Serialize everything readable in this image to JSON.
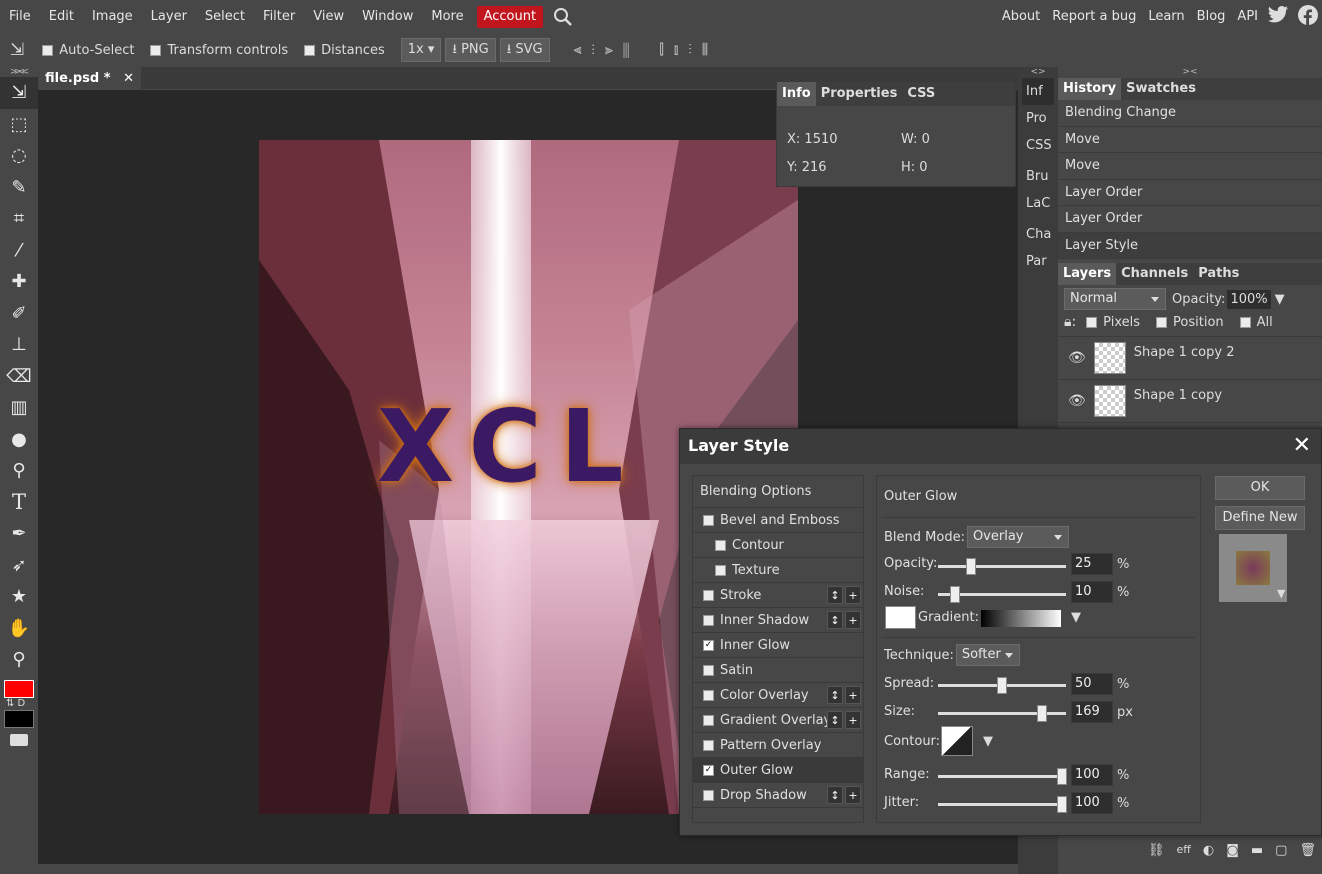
{
  "menu": {
    "items": [
      "File",
      "Edit",
      "Image",
      "Layer",
      "Select",
      "Filter",
      "View",
      "Window",
      "More"
    ],
    "account": "Account",
    "right": [
      "About",
      "Report a bug",
      "Learn",
      "Blog",
      "API"
    ]
  },
  "options": {
    "auto_select": "Auto-Select",
    "transform": "Transform controls",
    "distances": "Distances",
    "zoom": "1x",
    "png": "PNG",
    "svg": "SVG"
  },
  "document": {
    "tab": "file.psd *",
    "art_text": "XCL"
  },
  "info": {
    "tabs": [
      "Info",
      "Properties",
      "CSS"
    ],
    "x": "X: 1510",
    "y": "Y: 216",
    "w": "W: 0",
    "h": "H: 0"
  },
  "strip": [
    "Inf",
    "Pro",
    "CSS",
    "Bru",
    "LaC",
    "Cha",
    "Par"
  ],
  "history": {
    "tabs": [
      "History",
      "Swatches"
    ],
    "items": [
      "Blending Change",
      "Move",
      "Move",
      "Layer Order",
      "Layer Order",
      "Layer Style"
    ]
  },
  "layers": {
    "tabs": [
      "Layers",
      "Channels",
      "Paths"
    ],
    "blend": "Normal",
    "opacity_label": "Opacity:",
    "opacity": "100%",
    "lock_pixels": "Pixels",
    "lock_position": "Position",
    "lock_all": "All",
    "items": [
      "Shape 1 copy 2",
      "Shape 1 copy"
    ],
    "footer_eff": "eff"
  },
  "dialog": {
    "title": "Layer Style",
    "styles": [
      {
        "label": "Blending Options",
        "checked": null
      },
      {
        "label": "Bevel and Emboss",
        "checked": false
      },
      {
        "label": "Contour",
        "checked": false
      },
      {
        "label": "Texture",
        "checked": false
      },
      {
        "label": "Stroke",
        "checked": false
      },
      {
        "label": "Inner Shadow",
        "checked": false
      },
      {
        "label": "Inner Glow",
        "checked": true
      },
      {
        "label": "Satin",
        "checked": false
      },
      {
        "label": "Color Overlay",
        "checked": false
      },
      {
        "label": "Gradient Overlay",
        "checked": false
      },
      {
        "label": "Pattern Overlay",
        "checked": false
      },
      {
        "label": "Outer Glow",
        "checked": true
      },
      {
        "label": "Drop Shadow",
        "checked": false
      }
    ],
    "pane_title": "Outer Glow",
    "blend_mode_label": "Blend Mode:",
    "blend_mode": "Overlay",
    "opacity_label": "Opacity:",
    "opacity": "25",
    "noise_label": "Noise:",
    "noise": "10",
    "gradient_label": "Gradient:",
    "technique_label": "Technique:",
    "technique": "Softer",
    "spread_label": "Spread:",
    "spread": "50",
    "size_label": "Size:",
    "size": "169",
    "contour_label": "Contour:",
    "range_label": "Range:",
    "range": "100",
    "jitter_label": "Jitter:",
    "jitter": "100",
    "pct": "%",
    "px": "px",
    "ok": "OK",
    "define_new": "Define New"
  },
  "colors": {
    "account_bg": "#c2161f",
    "foreground": "#ff0000",
    "background": "#000000"
  }
}
